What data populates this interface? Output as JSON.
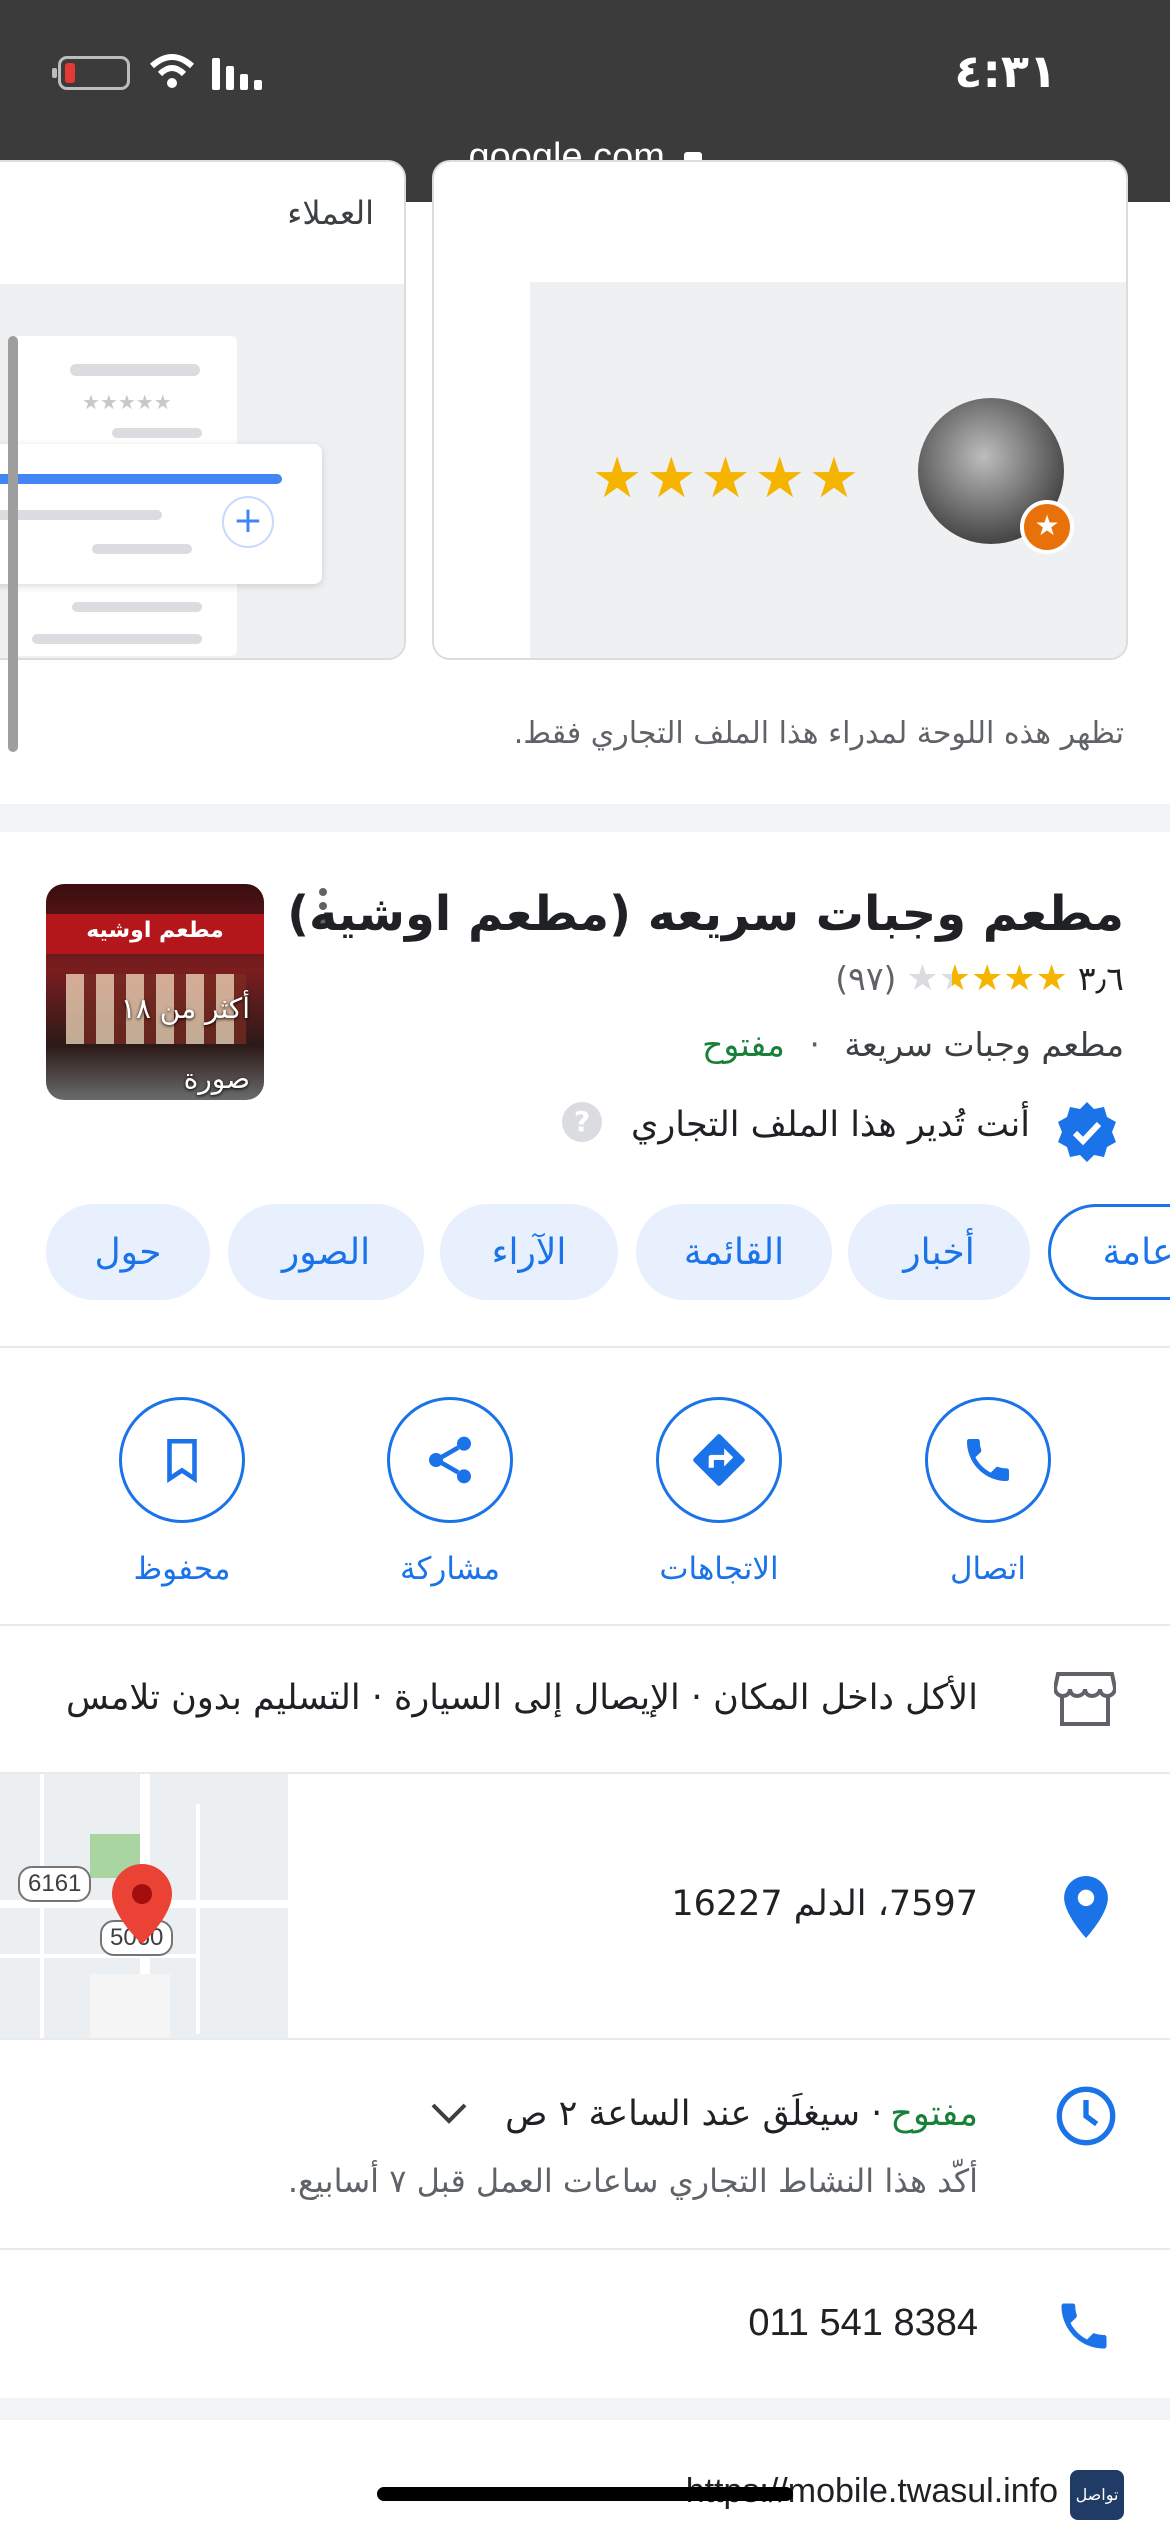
{
  "status_bar": {
    "time": "٤:٣١",
    "url": "google.com"
  },
  "top_cards": {
    "left_card_label": "العملاء",
    "panel_notice": "تظهر هذه اللوحة لمدراء هذا الملف التجاري فقط."
  },
  "business": {
    "name": "مطعم وجبات سريعه (مطعم اوشيه)",
    "rating": "٣٫٦",
    "rating_value": 3.6,
    "reviews_count": "(٩٧)",
    "category": "مطعم وجبات سريعة",
    "separator": "·",
    "open_status": "مفتوح",
    "manage_text": "أنت تُدير هذا الملف التجاري",
    "photos_label": "أكثر من ١٨ صورة",
    "photo_sign_text": "مطعم اوشيه"
  },
  "tabs": [
    {
      "label": "عامة"
    },
    {
      "label": "أخبار"
    },
    {
      "label": "القائمة"
    },
    {
      "label": "الآراء"
    },
    {
      "label": "الصور"
    },
    {
      "label": "حول"
    }
  ],
  "actions": [
    {
      "label": "اتصال",
      "icon": "phone-icon"
    },
    {
      "label": "الاتجاهات",
      "icon": "directions-icon"
    },
    {
      "label": "مشاركة",
      "icon": "share-icon"
    },
    {
      "label": "محفوظ",
      "icon": "bookmark-icon"
    }
  ],
  "details": {
    "service_options": "الأكل داخل المكان · الإيصال إلى السيارة · التسليم بدون تلامس",
    "address": "7597، الدلم 16227",
    "hours_status": "مفتوح",
    "hours_text": "· سيغلَق عند الساعة ٢ ص",
    "hours_note": "أكّد هذا النشاط التجاري ساعات العمل قبل ٧ أسابيع.",
    "phone": "011 541 8384",
    "website": "https://mobile.twasul.info",
    "website_icon_text": "تواصل"
  },
  "map": {
    "road_label_1": "6161",
    "road_label_2": "5060"
  },
  "colors": {
    "accent": "#1a73e8",
    "open_green": "#188038",
    "star": "#f4b400",
    "pin_red": "#ea4335"
  }
}
